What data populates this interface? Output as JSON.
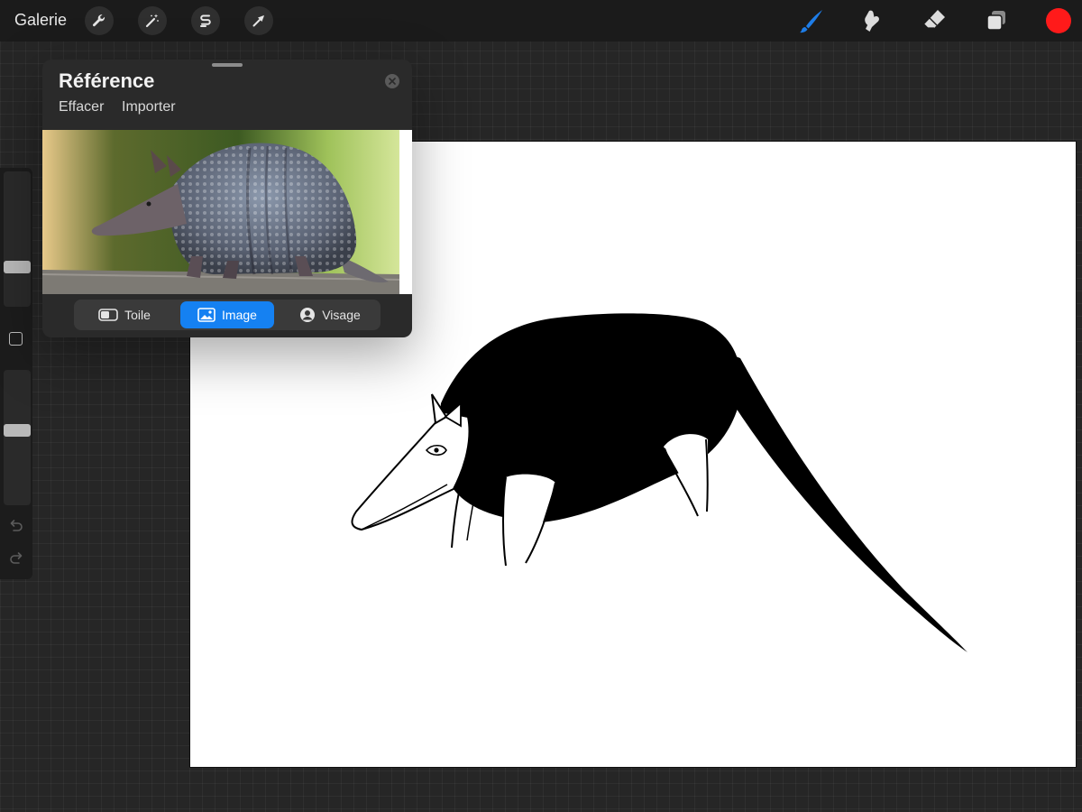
{
  "toolbar": {
    "gallery_label": "Galerie",
    "left_tools": [
      {
        "icon": "wrench-icon",
        "name": "actions-button"
      },
      {
        "icon": "magic-wand-icon",
        "name": "adjustments-button"
      },
      {
        "icon": "selection-icon",
        "name": "selection-button"
      },
      {
        "icon": "transform-arrow-icon",
        "name": "transform-button"
      }
    ],
    "right_tools": [
      {
        "icon": "brush-icon",
        "name": "brush-button",
        "active": true
      },
      {
        "icon": "smudge-icon",
        "name": "smudge-button"
      },
      {
        "icon": "eraser-icon",
        "name": "eraser-button"
      },
      {
        "icon": "layers-icon",
        "name": "layers-button"
      }
    ],
    "current_color": "#ff1a1a",
    "active_tool_color": "#1e7de8"
  },
  "sidebar": {
    "brush_size_level": 0.27,
    "opacity_level": 0.56
  },
  "reference": {
    "title": "Référence",
    "actions": [
      "Effacer",
      "Importer"
    ],
    "tabs": [
      {
        "label": "Toile",
        "icon": "canvas-icon",
        "active": false
      },
      {
        "label": "Image",
        "icon": "image-icon",
        "active": true
      },
      {
        "label": "Visage",
        "icon": "face-icon",
        "active": false
      }
    ],
    "image_subject": "armadillo photo"
  }
}
